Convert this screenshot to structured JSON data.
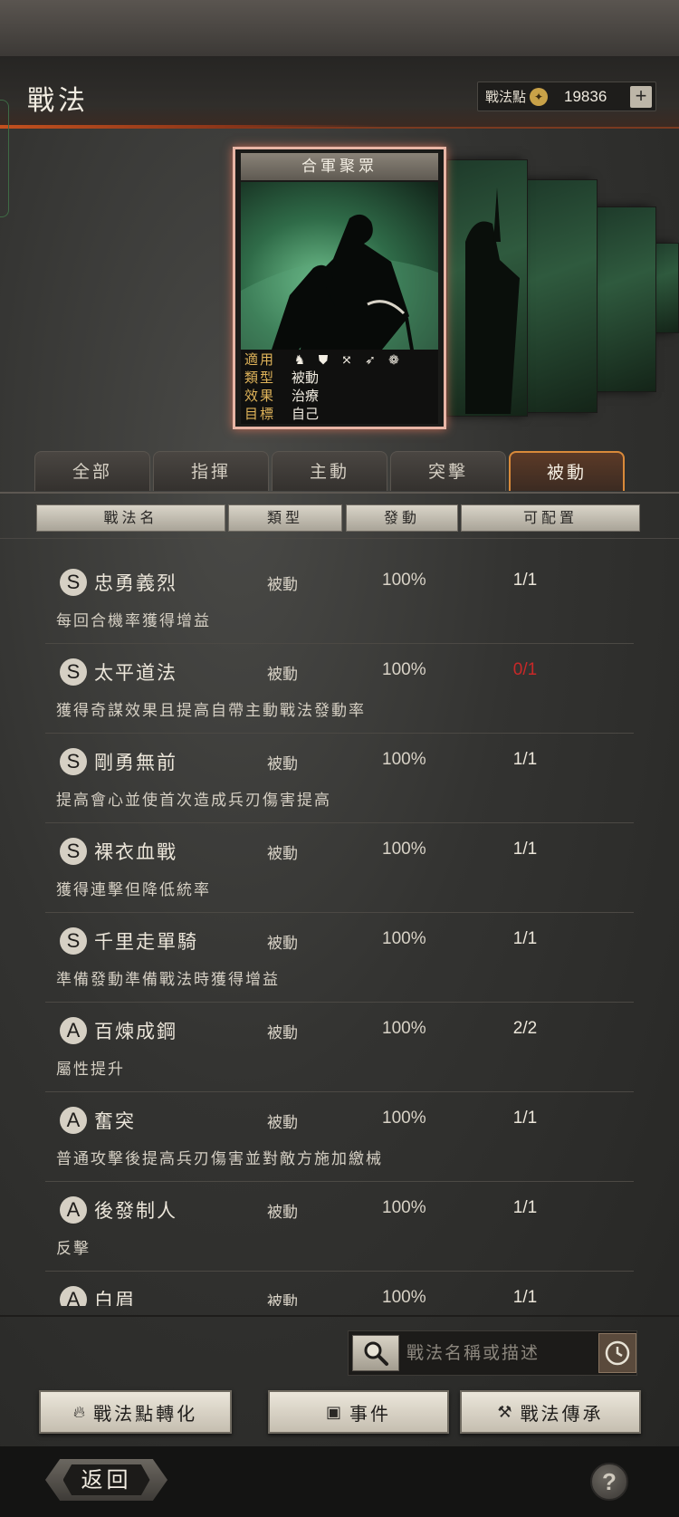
{
  "header": {
    "title": "戰法",
    "points_label": "戰法點",
    "points_value": "19836",
    "plus_label": "+"
  },
  "featured_card": {
    "title": "合軍聚眾",
    "info": [
      {
        "key": "適用",
        "value": ""
      },
      {
        "key": "類型",
        "value": "被動"
      },
      {
        "key": "效果",
        "value": "治療"
      },
      {
        "key": "目標",
        "value": "自己"
      }
    ],
    "unit_icons": [
      "cavalry-icon",
      "shield-icon",
      "bow-icon",
      "spear-icon",
      "wheel-icon"
    ]
  },
  "tabs": [
    {
      "label": "全部",
      "active": false
    },
    {
      "label": "指揮",
      "active": false
    },
    {
      "label": "主動",
      "active": false
    },
    {
      "label": "突擊",
      "active": false
    },
    {
      "label": "被動",
      "active": true
    }
  ],
  "columns": [
    "戰法名",
    "類型",
    "發動",
    "可配置"
  ],
  "skills": [
    {
      "grade": "S",
      "name": "忠勇義烈",
      "type": "被動",
      "rate": "100%",
      "capacity": "1/1",
      "capacity_color": "#ece6da",
      "desc": "每回合機率獲得增益"
    },
    {
      "grade": "S",
      "name": "太平道法",
      "type": "被動",
      "rate": "100%",
      "capacity": "0/1",
      "capacity_color": "#c82828",
      "desc": "獲得奇謀效果且提高自帶主動戰法發動率"
    },
    {
      "grade": "S",
      "name": "剛勇無前",
      "type": "被動",
      "rate": "100%",
      "capacity": "1/1",
      "capacity_color": "#ece6da",
      "desc": "提高會心並使首次造成兵刃傷害提高"
    },
    {
      "grade": "S",
      "name": "裸衣血戰",
      "type": "被動",
      "rate": "100%",
      "capacity": "1/1",
      "capacity_color": "#ece6da",
      "desc": "獲得連擊但降低統率"
    },
    {
      "grade": "S",
      "name": "千里走單騎",
      "type": "被動",
      "rate": "100%",
      "capacity": "1/1",
      "capacity_color": "#ece6da",
      "desc": "準備發動準備戰法時獲得增益"
    },
    {
      "grade": "A",
      "name": "百煉成鋼",
      "type": "被動",
      "rate": "100%",
      "capacity": "2/2",
      "capacity_color": "#ece6da",
      "desc": "屬性提升"
    },
    {
      "grade": "A",
      "name": "奮突",
      "type": "被動",
      "rate": "100%",
      "capacity": "1/1",
      "capacity_color": "#ece6da",
      "desc": "普通攻擊後提高兵刃傷害並對敵方施加繳械"
    },
    {
      "grade": "A",
      "name": "後發制人",
      "type": "被動",
      "rate": "100%",
      "capacity": "1/1",
      "capacity_color": "#ece6da",
      "desc": "反擊"
    },
    {
      "grade": "A",
      "name": "白眉",
      "type": "被動",
      "rate": "100%",
      "capacity": "1/1",
      "capacity_color": "#ece6da",
      "desc": ""
    }
  ],
  "search": {
    "placeholder": "戰法名稱或描述"
  },
  "actions": [
    {
      "label": "戰法點轉化",
      "icon": "flame-icon"
    },
    {
      "label": "事件",
      "icon": "ticket-icon"
    },
    {
      "label": "戰法傳承",
      "icon": "hammer-icon"
    }
  ],
  "footer": {
    "back_label": "返回",
    "help_label": "?"
  }
}
